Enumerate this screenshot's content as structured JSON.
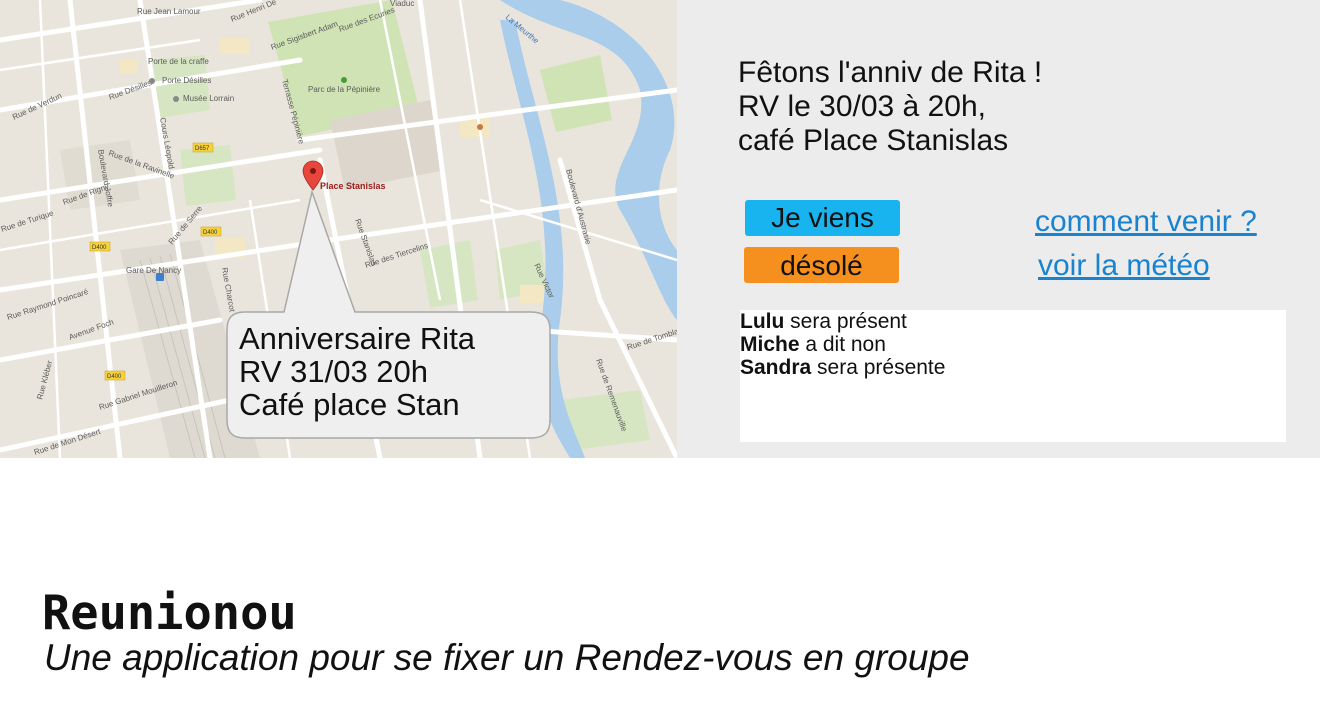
{
  "map": {
    "street_labels": [
      "Rue Jean Lamour",
      "Rue Henri Dé",
      "Rue Sigisbert Adam",
      "Rue des Ecuries",
      "Porte de la craffe",
      "Porte Désilles",
      "Musée Lorrain",
      "Rue Désilles",
      "Parc de la Pépinière",
      "Terrasse Pépinière",
      "Cours Léopold",
      "Rue de Serre",
      "Rue de Rigny",
      "Rue de Turique",
      "Gare De Nancy",
      "Rue Raymond Poincaré",
      "Avenue Foch",
      "Rue Gabriel Mouilleron",
      "Rue de Mon Désert",
      "Rue Kléber",
      "Rue des Tiercelins",
      "Boulevard d'Austrasie",
      "Rue Victor",
      "Rue de Tomblaine",
      "Rue de Remenauville",
      "La Meurthe",
      "Viaduc",
      "Rue de Verdun",
      "Rue Charcot",
      "Boulevard Joffre",
      "Rue Stanislas",
      "Rue de la Ravinelle"
    ],
    "road_badges": [
      "D657",
      "D400",
      "D400",
      "D400"
    ],
    "place_label": "Place Stanislas",
    "marker_icon": "map-pin-icon"
  },
  "bubble": {
    "line1": "Anniversaire Rita",
    "line2": "RV 31/03 20h",
    "line3": "Café place Stan"
  },
  "message": {
    "line1": "Fêtons l'anniv de Rita !",
    "line2": "RV le 30/03 à 20h,",
    "line3": "café Place Stanislas"
  },
  "buttons": {
    "yes_label": "Je viens",
    "no_label": "désolé",
    "yes_color": "#18b4f0",
    "no_color": "#f5901e"
  },
  "links": {
    "directions": "comment venir ?",
    "weather": "voir la météo"
  },
  "responses": [
    {
      "name": "Lulu",
      "status": " sera présent"
    },
    {
      "name": "Miche",
      "status": " a dit non"
    },
    {
      "name": "Sandra",
      "status": " sera présente"
    }
  ],
  "app": {
    "name": "Reunionou",
    "tagline": "Une application pour se fixer un Rendez-vous en groupe"
  }
}
